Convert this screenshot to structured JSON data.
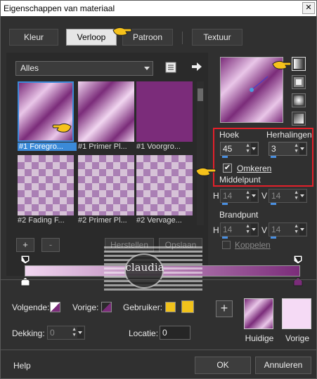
{
  "title": "Eigenschappen van materiaal",
  "close_glyph": "✕",
  "tabs": {
    "kleur": "Kleur",
    "verloop": "Verloop",
    "patroon": "Patroon",
    "textuur": "Textuur"
  },
  "category": "Alles",
  "thumbnails": [
    {
      "label": "#1 Foregro..."
    },
    {
      "label": "#1 Primer Pl..."
    },
    {
      "label": "#1 Voorgro..."
    },
    {
      "label": "#2 Fading F..."
    },
    {
      "label": "#2 Primer Pl..."
    },
    {
      "label": "#2 Vervage..."
    }
  ],
  "list_buttons": {
    "add": "+",
    "remove": "-",
    "restore": "Herstellen",
    "save": "Opslaan"
  },
  "properties": {
    "angle_label": "Hoek",
    "angle_value": "45",
    "repeats_label": "Herhalingen",
    "repeats_value": "3",
    "invert_label": "Omkeren",
    "invert_checked": true,
    "center_label": "Middelpunt",
    "h_label": "H",
    "v_label": "V",
    "center_h": "14",
    "center_v": "14",
    "focal_label": "Brandpunt",
    "focal_h": "14",
    "focal_v": "14",
    "link_label": "Koppelen"
  },
  "watermark": "claudia",
  "bottom": {
    "next_label": "Volgende:",
    "prev_label": "Vorige:",
    "user_label": "Gebruiker:",
    "opacity_label": "Dekking:",
    "opacity_value": "0",
    "location_label": "Locatie:",
    "location_value": "0",
    "add_glyph": "+",
    "current_label": "Huidige",
    "previous_label": "Vorige"
  },
  "footer": {
    "help": "Help",
    "ok": "OK",
    "cancel": "Annuleren"
  },
  "colors": {
    "primary": "#7b2c7a",
    "light": "#f1d6f0",
    "user_swatch": "#f1c21b",
    "highlight_box": "#e3202a",
    "selection": "#3b8ad8"
  }
}
